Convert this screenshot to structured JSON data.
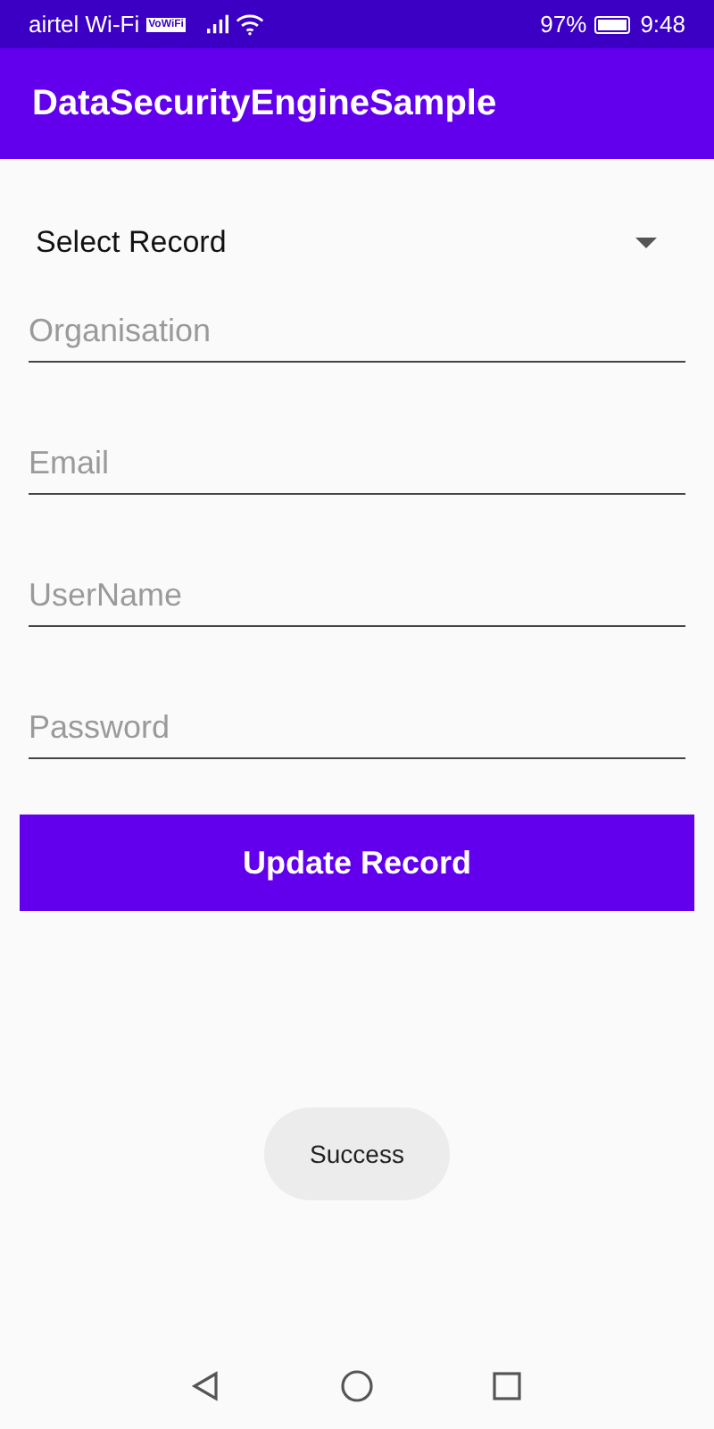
{
  "status_bar": {
    "carrier": "airtel Wi-Fi",
    "badge": "VoWiFi",
    "battery": "97%",
    "time": "9:48"
  },
  "app_bar": {
    "title": "DataSecurityEngineSample"
  },
  "spinner": {
    "value": "Select Record"
  },
  "fields": [
    {
      "placeholder": "Organisation"
    },
    {
      "placeholder": "Email"
    },
    {
      "placeholder": "UserName"
    },
    {
      "placeholder": "Password"
    }
  ],
  "button": {
    "label": "Update Record"
  },
  "toast": {
    "text": "Success"
  }
}
